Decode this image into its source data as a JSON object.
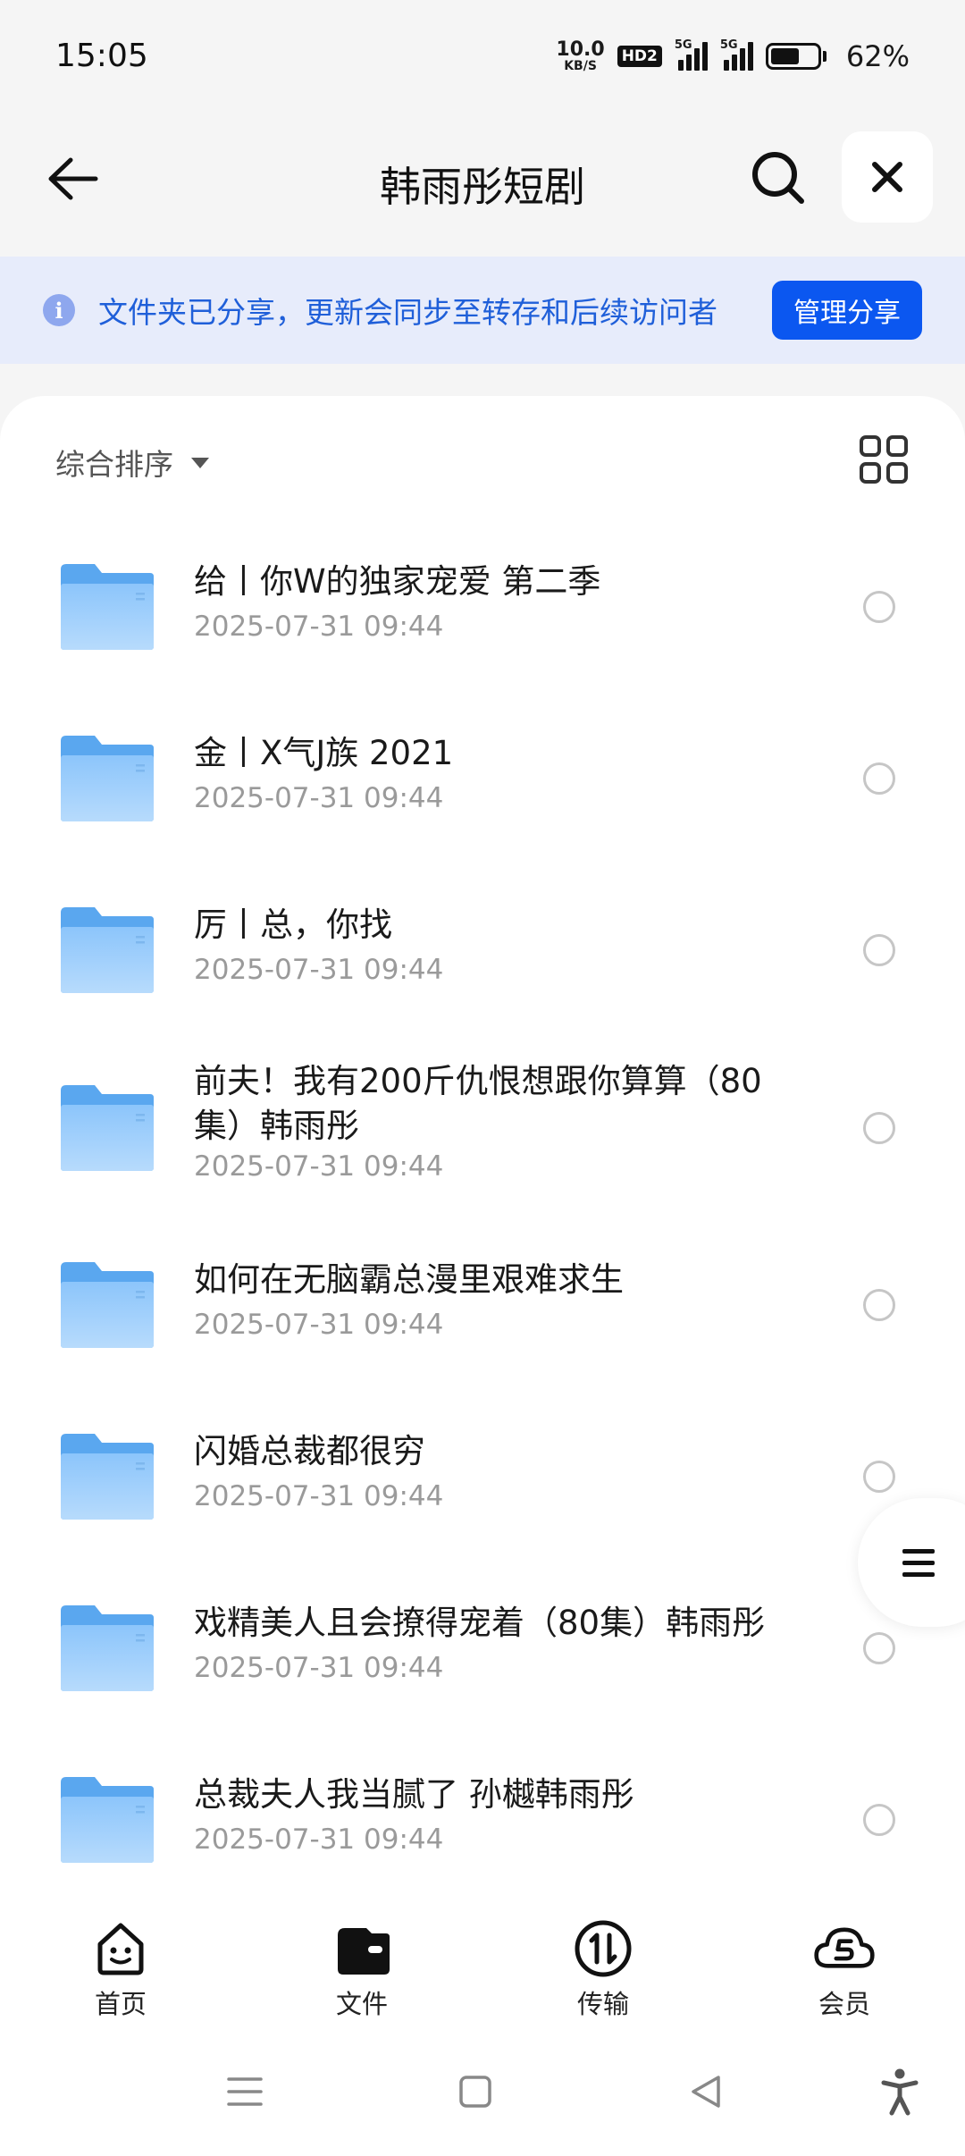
{
  "status_bar": {
    "time": "15:05",
    "net_speed_value": "10.0",
    "net_speed_unit": "KB/S",
    "hd_label": "HD2",
    "signal1_label": "5G",
    "signal2_label": "5G",
    "battery_level": 0.62,
    "battery_percent": "62%"
  },
  "header": {
    "title": "韩雨彤短剧",
    "back_icon": "arrow-left-icon",
    "search_icon": "search-icon",
    "close_icon": "close-icon"
  },
  "banner": {
    "info_symbol": "i",
    "text": "文件夹已分享，更新会同步至转存和后续访问者",
    "button_label": "管理分享"
  },
  "sort": {
    "label": "综合排序"
  },
  "files": [
    {
      "name": "给丨你W的独家宠爱 第二季",
      "date": "2025-07-31 09:44"
    },
    {
      "name": "金丨X气J族 2021",
      "date": "2025-07-31 09:44"
    },
    {
      "name": "厉丨总，你找",
      "date": "2025-07-31 09:44"
    },
    {
      "name": "前夫！我有200斤仇恨想跟你算算（80集）韩雨彤",
      "date": "2025-07-31 09:44"
    },
    {
      "name": "如何在无脑霸总漫里艰难求生",
      "date": "2025-07-31 09:44"
    },
    {
      "name": "闪婚总裁都很穷",
      "date": "2025-07-31 09:44"
    },
    {
      "name": "戏精美人且会撩得宠着（80集）韩雨彤",
      "date": "2025-07-31 09:44"
    },
    {
      "name": "总裁夫人我当腻了 孙樾韩雨彤",
      "date": "2025-07-31 09:44"
    }
  ],
  "bottom_nav": [
    {
      "label": "首页",
      "icon": "smiley-home-icon"
    },
    {
      "label": "文件",
      "icon": "wallet-file-icon"
    },
    {
      "label": "传输",
      "icon": "transfer-icon"
    },
    {
      "label": "会员",
      "icon": "cloud-member-icon"
    }
  ],
  "colors": {
    "accent": "#0b57f0",
    "banner_bg": "#e7ecfb",
    "banner_text": "#1f5fd9",
    "folder": "#64aef5"
  }
}
